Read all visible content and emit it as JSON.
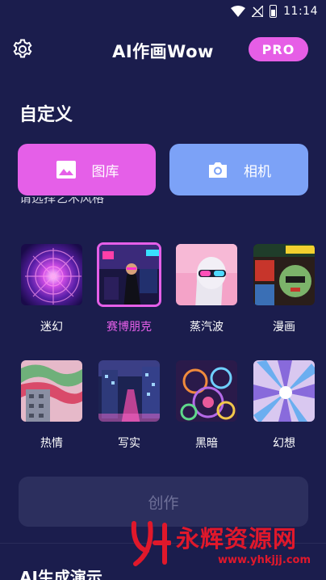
{
  "status_bar": {
    "time": "11:14"
  },
  "header": {
    "title": "AI作画Wow",
    "pro_label": "PRO"
  },
  "section": {
    "title": "自定义"
  },
  "actions": {
    "gallery_label": "图库",
    "camera_label": "相机"
  },
  "hint": "请选择艺术风格",
  "styles": [
    {
      "label": "迷幻",
      "selected": false
    },
    {
      "label": "赛博朋克",
      "selected": true
    },
    {
      "label": "蒸汽波",
      "selected": false
    },
    {
      "label": "漫画",
      "selected": false
    },
    {
      "label": "热情",
      "selected": false
    },
    {
      "label": "写实",
      "selected": false
    },
    {
      "label": "黑暗",
      "selected": false
    },
    {
      "label": "幻想",
      "selected": false
    }
  ],
  "create_label": "创作",
  "bottom_title": "AI生成演示",
  "watermark": {
    "text": "永辉资源网",
    "url": "www.yhkjjj.com"
  },
  "colors": {
    "background": "#1b1d4d",
    "accent_pink": "#e55fe8",
    "accent_blue": "#7ca2f7",
    "disabled_button": "#2c2f5e",
    "watermark_red": "#e0182b"
  }
}
